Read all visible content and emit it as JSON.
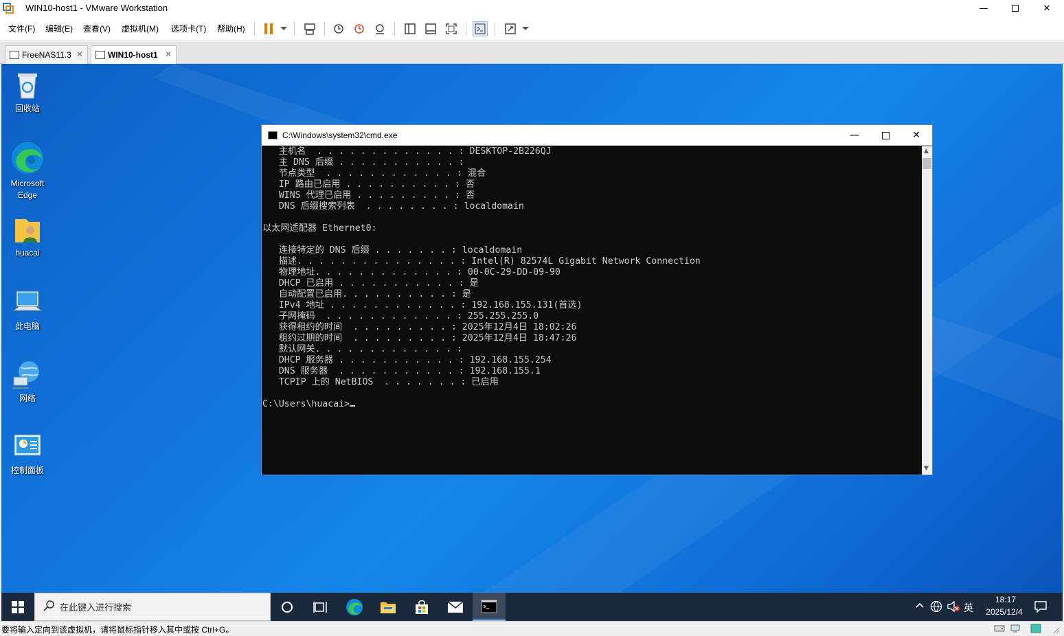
{
  "app": {
    "title": "WIN10-host1 - VMware Workstation"
  },
  "menu": [
    "文件(F)",
    "编辑(E)",
    "查看(V)",
    "虚拟机(M)",
    "选项卡(T)",
    "帮助(H)"
  ],
  "tabs": [
    {
      "label": "FreeNAS11.3",
      "active": false
    },
    {
      "label": "WIN10-host1",
      "active": true
    }
  ],
  "desktop_icons": [
    {
      "label": "回收站",
      "icon": "recycle-bin-icon"
    },
    {
      "label": "Microsoft Edge",
      "icon": "edge-icon"
    },
    {
      "label": "huacai",
      "icon": "user-folder-icon"
    },
    {
      "label": "此电脑",
      "icon": "this-pc-icon"
    },
    {
      "label": "网络",
      "icon": "network-icon"
    },
    {
      "label": "控制面板",
      "icon": "control-panel-icon"
    }
  ],
  "cmd": {
    "title": "C:\\Windows\\system32\\cmd.exe",
    "lines": [
      "   主机名  . . . . . . . . . . . . . : DESKTOP-2B226QJ",
      "   主 DNS 后缀 . . . . . . . . . . . :",
      "   节点类型  . . . . . . . . . . . . : 混合",
      "   IP 路由已启用 . . . . . . . . . . : 否",
      "   WINS 代理已启用 . . . . . . . . . : 否",
      "   DNS 后缀搜索列表  . . . . . . . . : localdomain",
      "",
      "以太网适配器 Ethernet0:",
      "",
      "   连接特定的 DNS 后缀 . . . . . . . : localdomain",
      "   描述. . . . . . . . . . . . . . . : Intel(R) 82574L Gigabit Network Connection",
      "   物理地址. . . . . . . . . . . . . : 00-0C-29-DD-09-90",
      "   DHCP 已启用 . . . . . . . . . . . : 是",
      "   自动配置已启用. . . . . . . . . . : 是",
      "   IPv4 地址 . . . . . . . . . . . . : 192.168.155.131(首选)",
      "   子网掩码  . . . . . . . . . . . . : 255.255.255.0",
      "   获得租约的时间  . . . . . . . . . : 2025年12月4日 18:02:26",
      "   租约过期的时间  . . . . . . . . . : 2025年12月4日 18:47:26",
      "   默认网关. . . . . . . . . . . . . :",
      "   DHCP 服务器 . . . . . . . . . . . : 192.168.155.254",
      "   DNS 服务器  . . . . . . . . . . . : 192.168.155.1",
      "   TCPIP 上的 NetBIOS  . . . . . . . : 已启用",
      "",
      "C:\\Users\\huacai>"
    ]
  },
  "taskbar": {
    "search_placeholder": "在此键入进行搜索",
    "ime": "英",
    "time": "18:17",
    "date": "2025/12/4"
  },
  "status": {
    "message": "要将输入定向到该虚拟机，请将鼠标指针移入其中或按 Ctrl+G。"
  },
  "colors": {
    "desktop": "#1177dd",
    "taskbar": "#1a2a3c",
    "console_bg": "#0c0c0c",
    "console_fg": "#cccccc"
  }
}
